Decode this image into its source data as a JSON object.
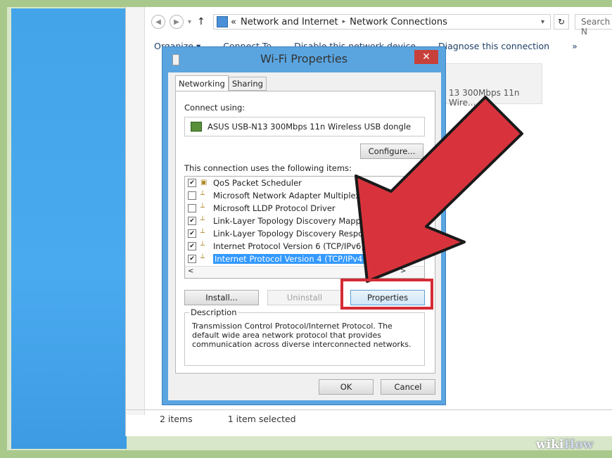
{
  "address_bar": {
    "breadcrumb_sep": "«",
    "crumbs": [
      "Network and Internet",
      "Network Connections"
    ],
    "search_placeholder": "Search N"
  },
  "command_bar": [
    "Organize ▾",
    "Connect To",
    "Disable this network device",
    "Diagnose this connection",
    "»"
  ],
  "device_tile": {
    "text": "13 300Mbps 11n Wire..."
  },
  "status_bar": {
    "count": "2 items",
    "selected": "1 item selected"
  },
  "dialog": {
    "title": "Wi-Fi Properties",
    "close": "✕",
    "tabs": [
      "Networking",
      "Sharing"
    ],
    "connect_using_label": "Connect using:",
    "adapter": "ASUS USB-N13 300Mbps 11n Wireless USB dongle",
    "configure_button": "Configure...",
    "items_label": "This connection uses the following items:",
    "items": [
      {
        "label": "QoS Packet Scheduler",
        "checked": true,
        "selected": false
      },
      {
        "label": "Microsoft Network Adapter Multiplexor Protocol",
        "checked": false,
        "selected": false
      },
      {
        "label": "Microsoft LLDP Protocol Driver",
        "checked": false,
        "selected": false
      },
      {
        "label": "Link-Layer Topology Discovery Mapper I/O Driver",
        "checked": true,
        "selected": false
      },
      {
        "label": "Link-Layer Topology Discovery Responder",
        "checked": true,
        "selected": false
      },
      {
        "label": "Internet Protocol Version 6 (TCP/IPv6)",
        "checked": true,
        "selected": false
      },
      {
        "label": "Internet Protocol Version 4 (TCP/IPv4)",
        "checked": true,
        "selected": true
      }
    ],
    "install_button": "Install...",
    "uninstall_button": "Uninstall",
    "properties_button": "Properties",
    "description_label": "Description",
    "description_text": "Transmission Control Protocol/Internet Protocol. The default wide area network protocol that provides communication across diverse interconnected networks.",
    "ok_button": "OK",
    "cancel_button": "Cancel"
  },
  "watermark": {
    "wiki": "wiki",
    "how": "How"
  },
  "colors": {
    "highlight": "#d52b35",
    "arrow": "#d8333c",
    "selection": "#3399ff"
  }
}
